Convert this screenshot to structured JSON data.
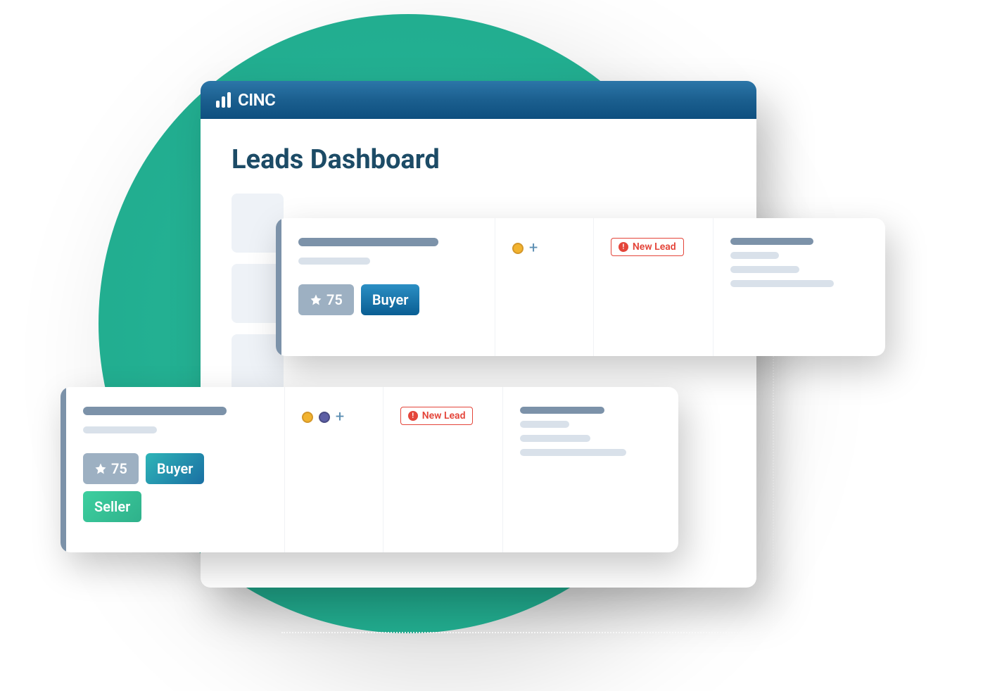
{
  "brand": "CINC",
  "page_title": "Leads Dashboard",
  "cards": {
    "card1": {
      "score": "75",
      "type_buyer": "Buyer",
      "status": "New Lead",
      "plus": "+"
    },
    "card2": {
      "score": "75",
      "type_buyer": "Buyer",
      "type_seller": "Seller",
      "status": "New Lead",
      "plus": "+"
    }
  }
}
